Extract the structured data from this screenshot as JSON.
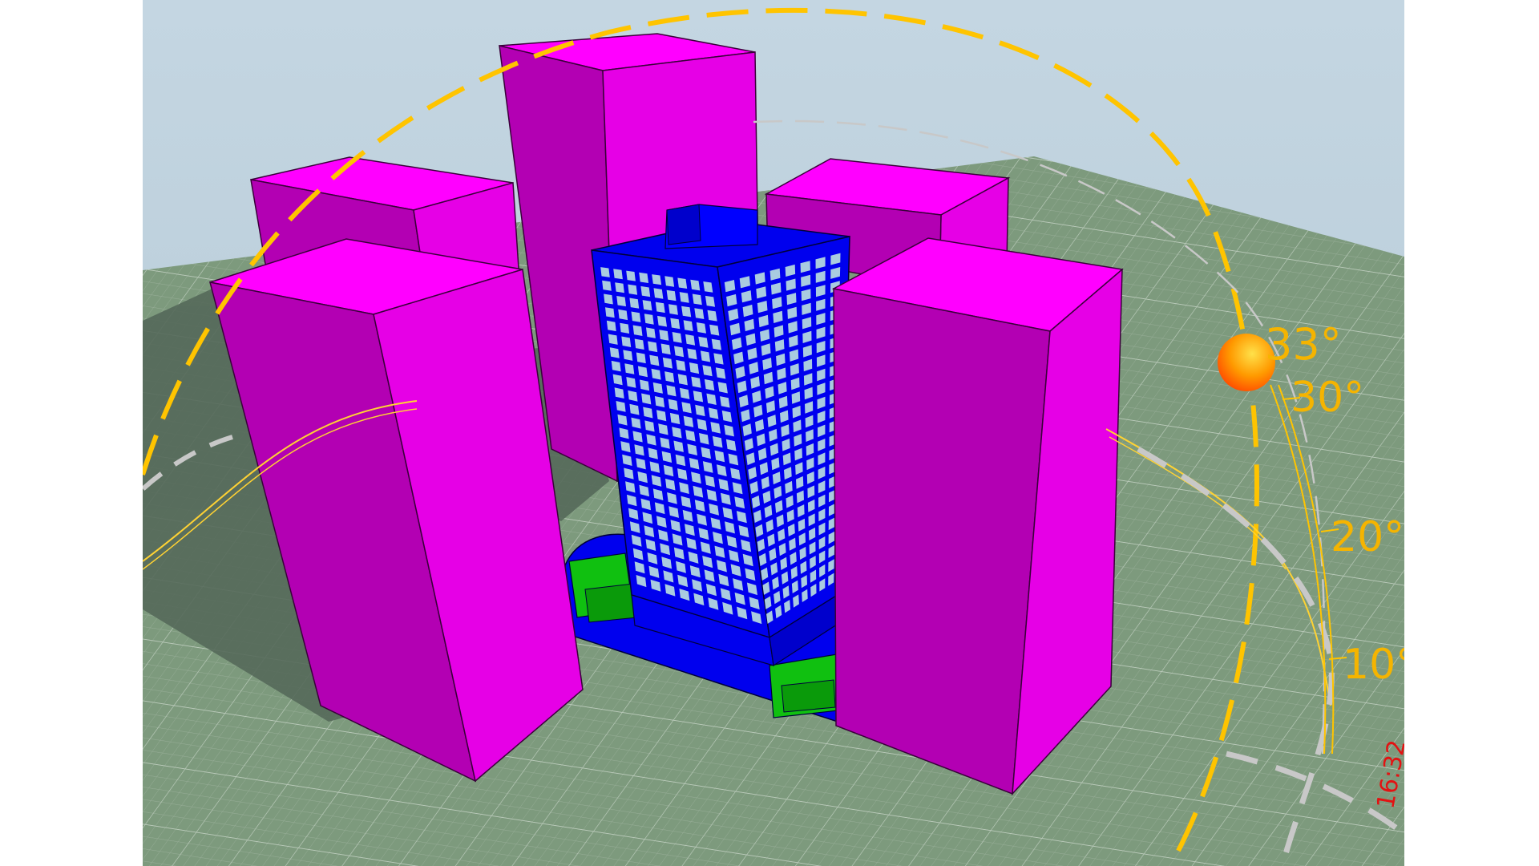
{
  "app": {
    "view_name": "3d-sun-study-viewport"
  },
  "colors": {
    "sky_top": "#bfd3df",
    "sky_bottom": "#b4c8d4",
    "ground": "#7d9a7d",
    "grid_minor": "#9db29d",
    "grid_major": "#c3d2c3",
    "shadow": "#56695a",
    "massing_top": "#ff00ff",
    "massing_left": "#b300b3",
    "massing_right": "#e000e0",
    "tower_frame": "#0000ee",
    "tower_glass": "#a9cbe0",
    "podium_green": "#10c010",
    "sun_path": "#ffc400",
    "altitude_label": "#f5b400",
    "time_label": "#e31212",
    "scale_grey": "#c8c8c8",
    "sun_core": "#ffd000",
    "sun_edge": "#ff5500"
  },
  "sun": {
    "altitude_deg": 33,
    "altitude_label": "33°"
  },
  "altitude_scale": {
    "ticks": [
      {
        "label": "30°"
      },
      {
        "label": "20°"
      },
      {
        "label": "10°"
      }
    ]
  },
  "time_markers": [
    {
      "label": "16:32"
    }
  ],
  "icons": {
    "sun": "sun-sphere"
  }
}
